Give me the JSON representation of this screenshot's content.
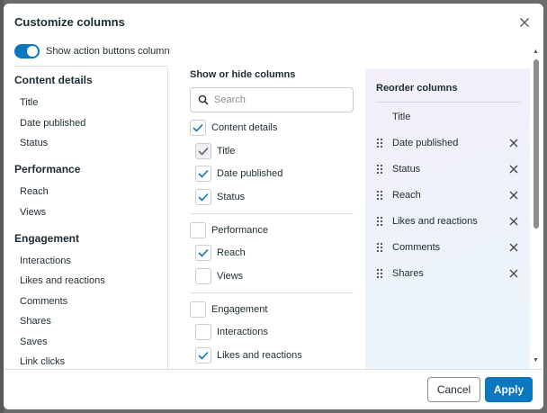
{
  "dialog": {
    "title": "Customize columns",
    "toggle_label": "Show action buttons column",
    "toggle_on": true
  },
  "left": {
    "sections": [
      {
        "heading": "Content details",
        "items": [
          "Title",
          "Date published",
          "Status"
        ]
      },
      {
        "heading": "Performance",
        "items": [
          "Reach",
          "Views"
        ]
      },
      {
        "heading": "Engagement",
        "items": [
          "Interactions",
          "Likes and reactions",
          "Comments",
          "Shares",
          "Saves",
          "Link clicks"
        ]
      }
    ]
  },
  "middle": {
    "heading": "Show or hide columns",
    "search_placeholder": "Search",
    "rows": [
      {
        "label": "Content details",
        "checked": true,
        "child": false
      },
      {
        "label": "Title",
        "checked": true,
        "child": true,
        "disabled": true
      },
      {
        "label": "Date published",
        "checked": true,
        "child": true
      },
      {
        "label": "Status",
        "checked": true,
        "child": true
      },
      {
        "label": "Performance",
        "checked": false,
        "child": false
      },
      {
        "label": "Reach",
        "checked": true,
        "child": true
      },
      {
        "label": "Views",
        "checked": false,
        "child": true
      },
      {
        "label": "Engagement",
        "checked": false,
        "child": false
      },
      {
        "label": "Interactions",
        "checked": false,
        "child": true
      },
      {
        "label": "Likes and reactions",
        "checked": true,
        "child": true
      }
    ]
  },
  "right": {
    "heading": "Reorder columns",
    "fixed_item": "Title",
    "items": [
      "Date published",
      "Status",
      "Reach",
      "Likes and reactions",
      "Comments",
      "Shares"
    ]
  },
  "footer": {
    "cancel_label": "Cancel",
    "apply_label": "Apply"
  },
  "colors": {
    "accent": "#0a78be",
    "text": "#1c2b33",
    "border": "#c8ccd1"
  }
}
